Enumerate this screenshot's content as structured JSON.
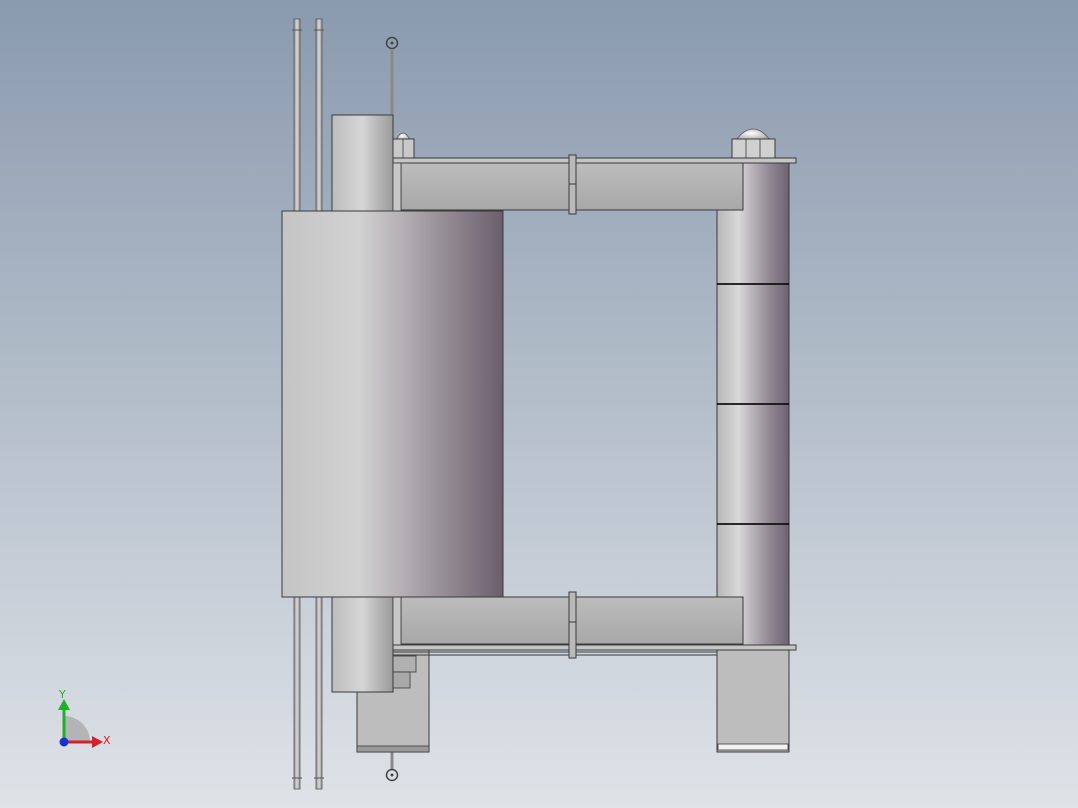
{
  "viewport": {
    "background_top": "#8a9aae",
    "background_bottom": "#dfe3e8"
  },
  "model": {
    "part_gray": "#c8c8c8",
    "shadow_mauve": "#6e6272",
    "edge_color": "#3a3a3a"
  },
  "triad": {
    "x_label": "X",
    "y_label": "Y",
    "x_color": "#d8202a",
    "y_color": "#1fb02a",
    "z_color": "#1a2fd0"
  }
}
